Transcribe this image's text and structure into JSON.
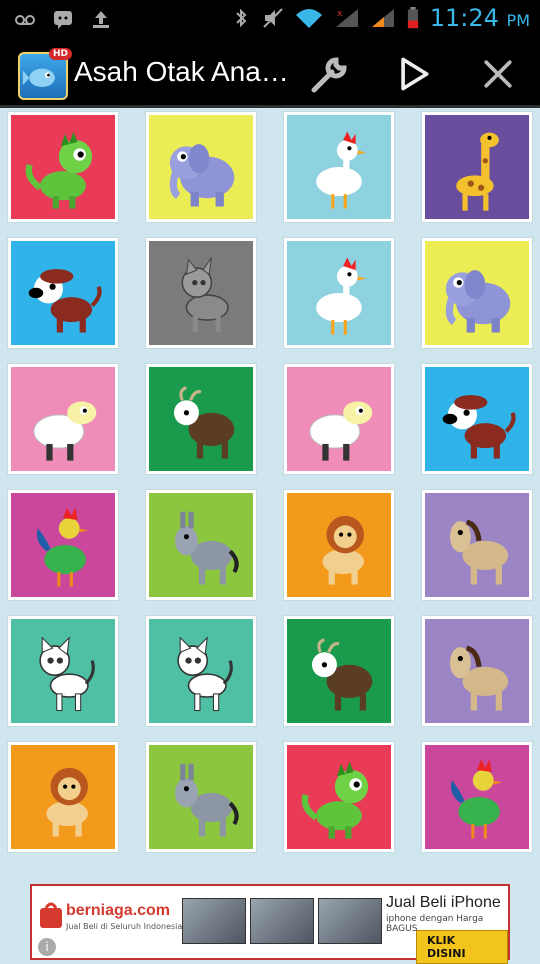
{
  "status_bar": {
    "time": "11:24",
    "ampm": "PM",
    "icons": [
      "voicemail-icon",
      "bbm-icon",
      "sync-icon",
      "bluetooth-icon",
      "mute-icon",
      "wifi-icon",
      "signal-1-icon",
      "signal-2-icon",
      "battery-icon"
    ]
  },
  "action_bar": {
    "title": "Asah Otak Ana…",
    "app_badge": "HD",
    "icons": [
      "settings-wrench-icon",
      "play-icon",
      "close-icon"
    ]
  },
  "grid": {
    "columns": 4,
    "rows": 6,
    "cards": [
      {
        "animal": "dragon",
        "bg": "#e93a57"
      },
      {
        "animal": "elephant",
        "bg": "#ecec54"
      },
      {
        "animal": "chicken",
        "bg": "#8fd2df"
      },
      {
        "animal": "giraffe",
        "bg": "#6a4e9e"
      },
      {
        "animal": "dog",
        "bg": "#2fb3e9"
      },
      {
        "animal": "cat-gray",
        "bg": "#7b7b7b"
      },
      {
        "animal": "chicken",
        "bg": "#8fd2df"
      },
      {
        "animal": "elephant",
        "bg": "#ecec54"
      },
      {
        "animal": "sheep",
        "bg": "#ef8cb8"
      },
      {
        "animal": "goat",
        "bg": "#199a4c"
      },
      {
        "animal": "sheep",
        "bg": "#ef8cb8"
      },
      {
        "animal": "dog",
        "bg": "#2fb3e9"
      },
      {
        "animal": "rooster",
        "bg": "#c9489c"
      },
      {
        "animal": "donkey",
        "bg": "#8cc63f"
      },
      {
        "animal": "lion",
        "bg": "#f39a1c"
      },
      {
        "animal": "horse",
        "bg": "#9c85c5"
      },
      {
        "animal": "cat",
        "bg": "#4fc0a4"
      },
      {
        "animal": "cat",
        "bg": "#4fc0a4"
      },
      {
        "animal": "goat",
        "bg": "#199a4c"
      },
      {
        "animal": "horse",
        "bg": "#9c85c5"
      },
      {
        "animal": "lion",
        "bg": "#f39a1c"
      },
      {
        "animal": "donkey",
        "bg": "#8cc63f"
      },
      {
        "animal": "dragon",
        "bg": "#e93a57"
      },
      {
        "animal": "rooster",
        "bg": "#c9489c"
      }
    ]
  },
  "ad": {
    "brand": "berniaga.com",
    "tagline": "Jual Beli di Seluruh Indonesia",
    "headline": "Jual Beli iPhone",
    "subline": "iphone dengan Harga BAGUS",
    "cta": "KLIK DISINI"
  },
  "colors": {
    "clock": "#39b7e8",
    "grid_bg": "#cfe6ee",
    "card_border": "#ffffff"
  }
}
